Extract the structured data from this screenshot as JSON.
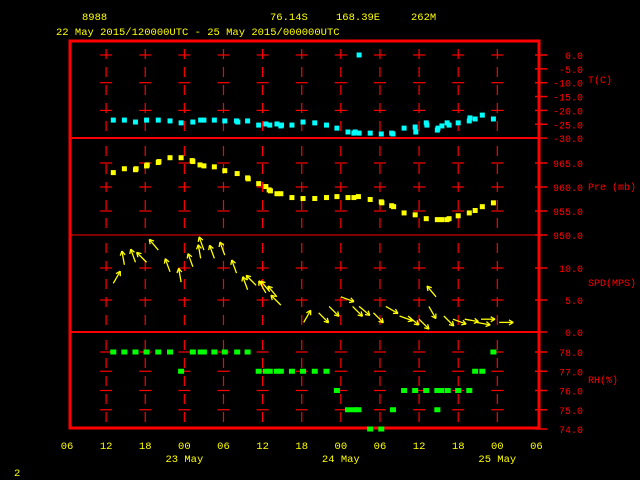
{
  "header": {
    "station": "8988",
    "lat": "76.14S",
    "lon": "168.39E",
    "elev": "262M",
    "period": "22 May 2015/120000UTC - 25 May 2015/000000UTC"
  },
  "page_number": "2",
  "colors": {
    "frame": "#ff0000",
    "text": "#ffff00",
    "temp": "#00ffff",
    "pres": "#ffff00",
    "wind": "#ffff00",
    "rh": "#00ff00"
  },
  "chart_data": [
    {
      "type": "scatter",
      "title": "T(C)",
      "ylabel": "T(C)",
      "ylim": [
        -30,
        0
      ],
      "yticks": [
        "0.0",
        "-5.0",
        "-10.0",
        "-15.0",
        "-20.0",
        "-25.0",
        "-30.0"
      ],
      "x_unit": "hours since 22 May 06UTC",
      "points": [
        [
          7.1,
          -23.5
        ],
        [
          8.8,
          -23.5
        ],
        [
          10.5,
          -24.2
        ],
        [
          12.2,
          -23.5
        ],
        [
          14.0,
          -23.5
        ],
        [
          15.8,
          -23.8
        ],
        [
          17.5,
          -24.5
        ],
        [
          19.3,
          -24.2
        ],
        [
          20.5,
          -23.5
        ],
        [
          21.0,
          -23.5
        ],
        [
          22.6,
          -23.5
        ],
        [
          24.2,
          -23.8
        ],
        [
          26.0,
          -23.8
        ],
        [
          26.2,
          -24.2
        ],
        [
          27.7,
          -23.8
        ],
        [
          29.4,
          -25.3
        ],
        [
          30.5,
          -24.9
        ],
        [
          31.1,
          -25.3
        ],
        [
          32.2,
          -24.9
        ],
        [
          32.8,
          -25.6
        ],
        [
          32.9,
          -25.3
        ],
        [
          34.5,
          -25.3
        ],
        [
          36.2,
          -24.2
        ],
        [
          38.0,
          -24.5
        ],
        [
          39.8,
          -25.3
        ],
        [
          41.4,
          -26.4
        ],
        [
          43.1,
          -27.8
        ],
        [
          44.0,
          -28.2
        ],
        [
          44.2,
          -27.8
        ],
        [
          44.8,
          0.0
        ],
        [
          44.8,
          -28.2
        ],
        [
          46.5,
          -28.2
        ],
        [
          48.2,
          -28.5
        ],
        [
          49.8,
          -28.2
        ],
        [
          50.0,
          -28.5
        ],
        [
          51.7,
          -26.4
        ],
        [
          53.4,
          -26.0
        ],
        [
          53.5,
          -27.8
        ],
        [
          55.1,
          -24.5
        ],
        [
          55.2,
          -25.3
        ],
        [
          56.8,
          -27.1
        ],
        [
          56.9,
          -26.4
        ],
        [
          57.5,
          -25.6
        ],
        [
          58.3,
          -24.5
        ],
        [
          58.6,
          -25.3
        ],
        [
          60.0,
          -24.5
        ],
        [
          61.7,
          -23.8
        ],
        [
          61.8,
          -22.7
        ],
        [
          62.6,
          -23.1
        ],
        [
          63.7,
          -21.7
        ],
        [
          65.4,
          -23.1
        ]
      ]
    },
    {
      "type": "scatter",
      "title": "Pre (mb)",
      "ylabel": "Pre (mb)",
      "ylim": [
        950,
        967.5
      ],
      "yticks": [
        "965.0",
        "960.0",
        "955.0",
        "950.0"
      ],
      "points": [
        [
          7.1,
          963.0
        ],
        [
          8.8,
          963.8
        ],
        [
          10.5,
          963.6
        ],
        [
          10.6,
          963.8
        ],
        [
          12.2,
          964.4
        ],
        [
          12.3,
          964.6
        ],
        [
          14.0,
          965.1
        ],
        [
          14.1,
          965.3
        ],
        [
          15.8,
          966.1
        ],
        [
          17.5,
          966.1
        ],
        [
          19.2,
          965.5
        ],
        [
          19.3,
          965.3
        ],
        [
          20.4,
          964.6
        ],
        [
          21.0,
          964.4
        ],
        [
          22.6,
          964.2
        ],
        [
          24.2,
          963.4
        ],
        [
          26.1,
          962.8
        ],
        [
          27.7,
          961.9
        ],
        [
          27.8,
          961.7
        ],
        [
          29.4,
          960.7
        ],
        [
          30.5,
          960.1
        ],
        [
          31.0,
          959.4
        ],
        [
          31.2,
          959.2
        ],
        [
          32.2,
          958.6
        ],
        [
          32.8,
          958.6
        ],
        [
          34.5,
          957.8
        ],
        [
          36.2,
          957.6
        ],
        [
          38.0,
          957.6
        ],
        [
          39.8,
          957.8
        ],
        [
          41.4,
          958.0
        ],
        [
          43.1,
          957.8
        ],
        [
          44.0,
          957.8
        ],
        [
          44.7,
          958.0
        ],
        [
          46.5,
          957.4
        ],
        [
          48.2,
          956.9
        ],
        [
          48.3,
          956.7
        ],
        [
          49.8,
          956.1
        ],
        [
          50.1,
          955.9
        ],
        [
          51.7,
          954.6
        ],
        [
          53.4,
          954.2
        ],
        [
          55.1,
          953.4
        ],
        [
          56.8,
          953.2
        ],
        [
          57.5,
          953.2
        ],
        [
          58.3,
          953.2
        ],
        [
          58.6,
          953.4
        ],
        [
          60.0,
          954.0
        ],
        [
          61.7,
          954.6
        ],
        [
          62.6,
          955.1
        ],
        [
          63.7,
          955.9
        ],
        [
          65.4,
          956.7
        ]
      ]
    },
    {
      "type": "vector",
      "title": "SPD(MPS)",
      "ylabel": "SPD(MPS)",
      "ylim": [
        0,
        15
      ],
      "yticks": [
        "10.0",
        "5.0",
        "0.0"
      ],
      "points_note": "[hour, speed m/s, arrow direction deg (0=east, 90=north)]",
      "points": [
        [
          7.1,
          7.6,
          60
        ],
        [
          8.8,
          10.5,
          100
        ],
        [
          10.5,
          10.9,
          110
        ],
        [
          12.2,
          10.9,
          135
        ],
        [
          14.0,
          12.8,
          130
        ],
        [
          15.8,
          9.4,
          110
        ],
        [
          17.5,
          7.8,
          100
        ],
        [
          19.3,
          10.2,
          110
        ],
        [
          20.5,
          11.5,
          100
        ],
        [
          21.0,
          12.8,
          110
        ],
        [
          22.6,
          11.5,
          110
        ],
        [
          24.2,
          12.0,
          110
        ],
        [
          26.0,
          9.2,
          110
        ],
        [
          27.7,
          6.6,
          110
        ],
        [
          29.0,
          7.3,
          135
        ],
        [
          30.5,
          6.1,
          120
        ],
        [
          31.1,
          6.3,
          130
        ],
        [
          32.2,
          5.5,
          130
        ],
        [
          32.8,
          4.2,
          135
        ],
        [
          36.3,
          1.5,
          60
        ],
        [
          38.6,
          3.0,
          -45
        ],
        [
          40.2,
          4.0,
          -45
        ],
        [
          42.0,
          5.5,
          -20
        ],
        [
          43.8,
          4.0,
          -45
        ],
        [
          44.8,
          4.0,
          -40
        ],
        [
          47.0,
          3.0,
          -45
        ],
        [
          48.9,
          4.0,
          -30
        ],
        [
          51.0,
          2.5,
          -20
        ],
        [
          52.3,
          2.5,
          -40
        ],
        [
          54.0,
          2.0,
          -45
        ],
        [
          55.5,
          4.0,
          -60
        ],
        [
          56.6,
          5.5,
          130
        ],
        [
          57.8,
          2.5,
          -45
        ],
        [
          59.2,
          2.0,
          -20
        ],
        [
          61.0,
          2.0,
          -10
        ],
        [
          62.8,
          1.5,
          -10
        ],
        [
          63.5,
          2.0,
          0
        ],
        [
          66.3,
          1.5,
          0
        ]
      ]
    },
    {
      "type": "scatter",
      "title": "RH(%)",
      "ylabel": "RH(%)",
      "ylim": [
        74,
        78
      ],
      "yticks": [
        "78.0",
        "77.0",
        "76.0",
        "75.0",
        "74.0"
      ],
      "points": [
        [
          7.1,
          78
        ],
        [
          8.8,
          78
        ],
        [
          10.5,
          78
        ],
        [
          12.2,
          78
        ],
        [
          14.0,
          78
        ],
        [
          15.8,
          78
        ],
        [
          17.5,
          77
        ],
        [
          19.3,
          78
        ],
        [
          20.5,
          78
        ],
        [
          21.0,
          78
        ],
        [
          22.6,
          78
        ],
        [
          24.2,
          78
        ],
        [
          26.1,
          78
        ],
        [
          27.7,
          78
        ],
        [
          29.4,
          77
        ],
        [
          30.5,
          77
        ],
        [
          31.1,
          77
        ],
        [
          32.2,
          77
        ],
        [
          32.8,
          77
        ],
        [
          34.5,
          77
        ],
        [
          36.2,
          77
        ],
        [
          38.0,
          77
        ],
        [
          39.8,
          77
        ],
        [
          41.4,
          76
        ],
        [
          43.1,
          75
        ],
        [
          44.0,
          75
        ],
        [
          44.7,
          75
        ],
        [
          46.5,
          74
        ],
        [
          48.2,
          74
        ],
        [
          50.0,
          75
        ],
        [
          51.7,
          76
        ],
        [
          53.4,
          76
        ],
        [
          55.1,
          76
        ],
        [
          56.8,
          76
        ],
        [
          56.8,
          75
        ],
        [
          57.4,
          76
        ],
        [
          58.4,
          76
        ],
        [
          60.0,
          76
        ],
        [
          61.7,
          76
        ],
        [
          62.6,
          77
        ],
        [
          63.7,
          77
        ],
        [
          65.4,
          78
        ]
      ]
    }
  ],
  "x_axis": {
    "ticks": [
      "06",
      "12",
      "18",
      "00",
      "06",
      "12",
      "18",
      "00",
      "06",
      "12",
      "18",
      "00",
      "06"
    ],
    "dates": [
      "23 May",
      "24 May",
      "25 May"
    ]
  }
}
